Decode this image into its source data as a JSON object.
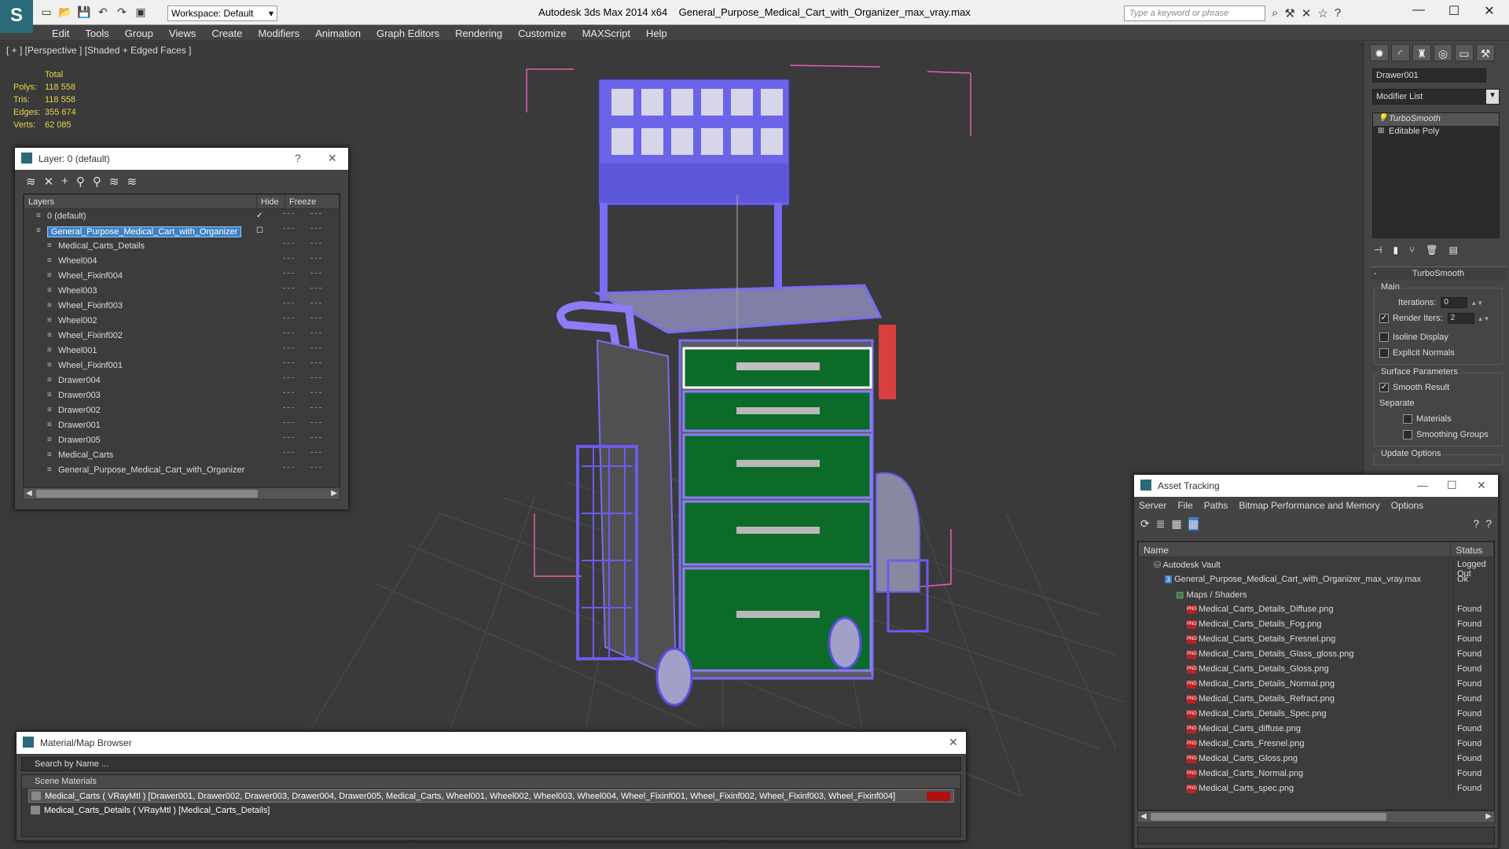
{
  "titlebar": {
    "workspace": "Workspace: Default",
    "app": "Autodesk 3ds Max  2014 x64",
    "file": "General_Purpose_Medical_Cart_with_Organizer_max_vray.max",
    "search_placeholder": "Type a keyword or phrase"
  },
  "menu": [
    "Edit",
    "Tools",
    "Group",
    "Views",
    "Create",
    "Modifiers",
    "Animation",
    "Graph Editors",
    "Rendering",
    "Customize",
    "MAXScript",
    "Help"
  ],
  "viewport": {
    "label": "[ + ] [Perspective ] [Shaded + Edged Faces ]",
    "stats": {
      "header": "Total",
      "polys_label": "Polys:",
      "polys": "118 558",
      "tris_label": "Tris:",
      "tris": "118 558",
      "edges_label": "Edges:",
      "edges": "355 674",
      "verts_label": "Verts:",
      "verts": "62 085"
    }
  },
  "command_panel": {
    "object_name": "Drawer001",
    "modifier_list": "Modifier List",
    "stack": [
      "TurboSmooth",
      "Editable Poly"
    ],
    "rollout": "TurboSmooth",
    "main_group": "Main",
    "iterations_label": "Iterations:",
    "iterations": "0",
    "render_iters_label": "Render Iters:",
    "render_iters": "2",
    "isoline": "Isoline Display",
    "explicit_normals": "Explicit Normals",
    "surface_group": "Surface Parameters",
    "smooth_result": "Smooth Result",
    "separate": "Separate",
    "materials": "Materials",
    "smoothing_groups": "Smoothing Groups",
    "update_group": "Update Options"
  },
  "layer_panel": {
    "title": "Layer: 0 (default)",
    "help": "?",
    "col_layers": "Layers",
    "col_hide": "Hide",
    "col_freeze": "Freeze",
    "rows": [
      {
        "name": "0 (default)",
        "level": 0
      },
      {
        "name": "General_Purpose_Medical_Cart_with_Organizer",
        "level": 0
      },
      {
        "name": "Medical_Carts_Details",
        "level": 1
      },
      {
        "name": "Wheel004",
        "level": 1
      },
      {
        "name": "Wheel_Fixinf004",
        "level": 1
      },
      {
        "name": "Wheel003",
        "level": 1
      },
      {
        "name": "Wheel_Fixinf003",
        "level": 1
      },
      {
        "name": "Wheel002",
        "level": 1
      },
      {
        "name": "Wheel_Fixinf002",
        "level": 1
      },
      {
        "name": "Wheel001",
        "level": 1
      },
      {
        "name": "Wheel_Fixinf001",
        "level": 1
      },
      {
        "name": "Drawer004",
        "level": 1
      },
      {
        "name": "Drawer003",
        "level": 1
      },
      {
        "name": "Drawer002",
        "level": 1
      },
      {
        "name": "Drawer001",
        "level": 1
      },
      {
        "name": "Drawer005",
        "level": 1
      },
      {
        "name": "Medical_Carts",
        "level": 1
      },
      {
        "name": "General_Purpose_Medical_Cart_with_Organizer",
        "level": 1
      }
    ]
  },
  "asset_panel": {
    "title": "Asset Tracking",
    "menu": [
      "Server",
      "File",
      "Paths",
      "Bitmap Performance and Memory",
      "Options"
    ],
    "col_name": "Name",
    "col_status": "Status",
    "rows": [
      {
        "name": "Autodesk Vault",
        "status": "Logged Out",
        "indent": 1
      },
      {
        "name": "General_Purpose_Medical_Cart_with_Organizer_max_vray.max",
        "status": "Ok",
        "indent": 2
      },
      {
        "name": "Maps / Shaders",
        "status": "",
        "indent": 3
      },
      {
        "name": "Medical_Carts_Details_Diffuse.png",
        "status": "Found",
        "indent": 4
      },
      {
        "name": "Medical_Carts_Details_Fog.png",
        "status": "Found",
        "indent": 4
      },
      {
        "name": "Medical_Carts_Details_Fresnel.png",
        "status": "Found",
        "indent": 4
      },
      {
        "name": "Medical_Carts_Details_Glass_gloss.png",
        "status": "Found",
        "indent": 4
      },
      {
        "name": "Medical_Carts_Details_Gloss.png",
        "status": "Found",
        "indent": 4
      },
      {
        "name": "Medical_Carts_Details_Normal.png",
        "status": "Found",
        "indent": 4
      },
      {
        "name": "Medical_Carts_Details_Refract.png",
        "status": "Found",
        "indent": 4
      },
      {
        "name": "Medical_Carts_Details_Spec.png",
        "status": "Found",
        "indent": 4
      },
      {
        "name": "Medical_Carts_diffuse.png",
        "status": "Found",
        "indent": 4
      },
      {
        "name": "Medical_Carts_Fresnel.png",
        "status": "Found",
        "indent": 4
      },
      {
        "name": "Medical_Carts_Gloss.png",
        "status": "Found",
        "indent": 4
      },
      {
        "name": "Medical_Carts_Normal.png",
        "status": "Found",
        "indent": 4
      },
      {
        "name": "Medical_Carts_spec.png",
        "status": "Found",
        "indent": 4
      }
    ]
  },
  "material_panel": {
    "title": "Material/Map Browser",
    "search": "Search by Name ...",
    "section": "Scene Materials",
    "rows": [
      "Medical_Carts  ( VRayMtl )  [Drawer001, Drawer002, Drawer003, Drawer004, Drawer005, Medical_Carts, Wheel001, Wheel002, Wheel003, Wheel004, Wheel_Fixinf001, Wheel_Fixinf002, Wheel_Fixinf003, Wheel_Fixinf004]",
      "Medical_Carts_Details ( VRayMtl ) [Medical_Carts_Details]"
    ]
  },
  "colors": {
    "accent": "#3b82c6",
    "drawer_green": "#0d6b2a",
    "wire": "#7a6cf5",
    "selection_box": "#e040a0"
  }
}
